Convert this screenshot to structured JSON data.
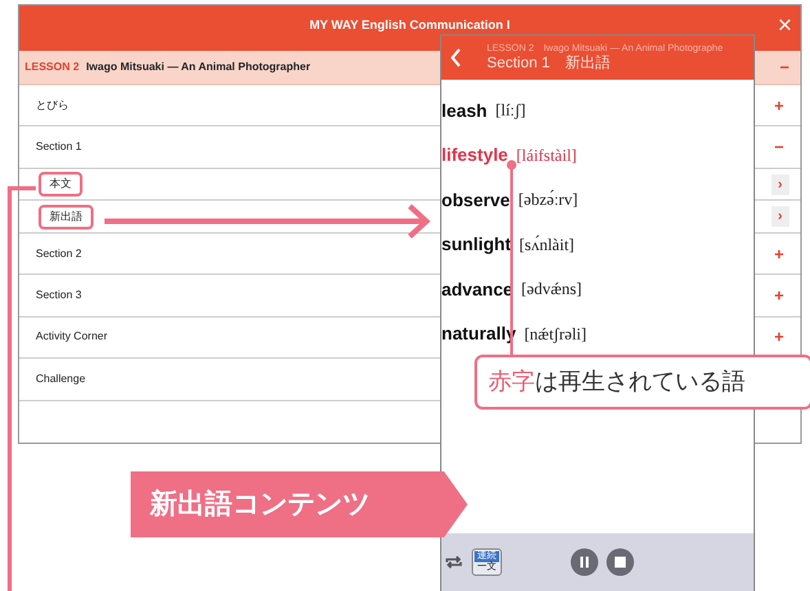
{
  "window": {
    "title": "MY WAY English Communication I",
    "close": "×"
  },
  "lesson": {
    "number": "LESSON 2",
    "title": "Iwago Mitsuaki — An Animal Photographer",
    "sign": "−"
  },
  "rows": [
    {
      "label": "とびら",
      "kind": "item",
      "sign": "+",
      "boxed": false
    },
    {
      "label": "Section 1",
      "kind": "item",
      "sign": "−",
      "boxed": false
    },
    {
      "label": "本文",
      "kind": "sub",
      "sign": "›",
      "boxed": true
    },
    {
      "label": "新出語",
      "kind": "sub",
      "sign": "›",
      "boxed": true
    },
    {
      "label": "Section 2",
      "kind": "item",
      "sign": "+",
      "boxed": false
    },
    {
      "label": "Section 3",
      "kind": "item",
      "sign": "+",
      "boxed": false
    },
    {
      "label": "Activity Corner",
      "kind": "item",
      "sign": "+",
      "boxed": false
    },
    {
      "label": "Challenge",
      "kind": "item",
      "sign": "",
      "boxed": false
    }
  ],
  "panel": {
    "lesson": "LESSON 2",
    "lesson_title": "Iwago Mitsuaki — An Animal Photographe",
    "heading": "Section 1　新出語",
    "words": [
      {
        "word": "leash",
        "pron": "[líːʃ]",
        "playing": false
      },
      {
        "word": "lifestyle",
        "pron": "[láifstàil]",
        "playing": true
      },
      {
        "word": "observe",
        "pron": "[əbzə́ːrv]",
        "playing": false
      },
      {
        "word": "sunlight",
        "pron": "[sʌ́nlàit]",
        "playing": false
      },
      {
        "word": "advance",
        "pron": "[ədvǽns]",
        "playing": false
      },
      {
        "word": "naturally",
        "pron": "[nǽtʃrəli]",
        "playing": false
      }
    ],
    "mode_top": "連続",
    "mode_bottom": "一文"
  },
  "annotations": {
    "note_highlight": "赤字",
    "note_text": "は再生されている語",
    "banner": "新出語コンテンツ"
  }
}
